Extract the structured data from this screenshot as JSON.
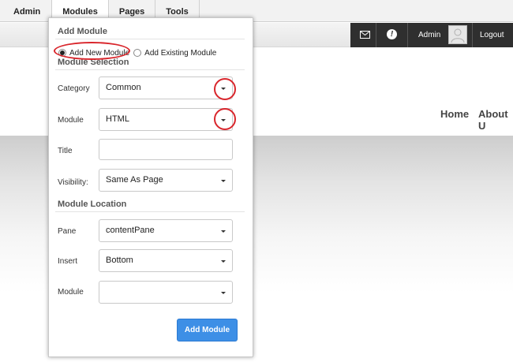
{
  "topbar": {
    "menu": [
      "Admin",
      "Modules",
      "Pages",
      "Tools"
    ]
  },
  "persona": {
    "user": "Admin",
    "logout": "Logout"
  },
  "site": {
    "nav": [
      "Home",
      "About U"
    ]
  },
  "panel": {
    "title": "Add Module",
    "radio_new": "Add New Module",
    "radio_existing": "Add Existing Module",
    "selection_heading": "Module Selection",
    "category_label": "Category",
    "category_value": "Common",
    "module_label": "Module",
    "module_value": "HTML",
    "title_label": "Title",
    "title_value": "",
    "visibility_label": "Visibility:",
    "visibility_value": "Same As Page",
    "location_heading": "Module Location",
    "pane_label": "Pane",
    "pane_value": "contentPane",
    "insert_label": "Insert",
    "insert_value": "Bottom",
    "module2_label": "Module",
    "module2_value": "",
    "add_button": "Add Module"
  },
  "colors": {
    "accent": "#3d8fe6",
    "highlight": "#d9262c",
    "persona_dark": "#2f2f2f"
  }
}
